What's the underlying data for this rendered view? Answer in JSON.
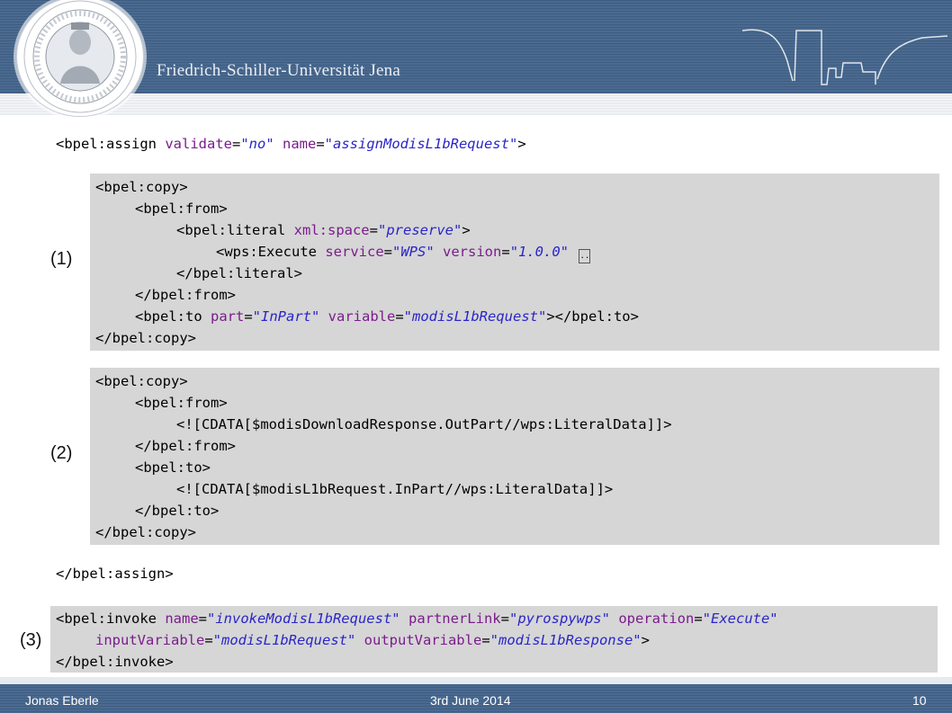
{
  "header": {
    "university_name": "Friedrich-Schiller-Universität Jena"
  },
  "code": {
    "assign_open": {
      "tag": "<bpel:assign ",
      "attr1": "validate",
      "val1": "\"no\"",
      "attr2": "name",
      "val2": "\"assignModisL1bRequest\"",
      "close": ">"
    },
    "block1": {
      "label": "(1)",
      "l1": "<bpel:copy>",
      "l2": "<bpel:from>",
      "l3_tag": "<bpel:literal ",
      "l3_attr": "xml:space",
      "l3_val": "\"preserve\"",
      "l3_close": ">",
      "l4_tag": "<wps:Execute ",
      "l4_attr1": "service",
      "l4_val1": "\"WPS\"",
      "l4_attr2": "version",
      "l4_val2": "\"1.0.0\"",
      "l4_ellipsis": "..",
      "l5": "</bpel:literal>",
      "l6": "</bpel:from>",
      "l7_tag": "<bpel:to ",
      "l7_attr1": "part",
      "l7_val1": "\"InPart\"",
      "l7_attr2": "variable",
      "l7_val2": "\"modisL1bRequest\"",
      "l7_close": "></bpel:to>",
      "l8": "</bpel:copy>"
    },
    "block2": {
      "label": "(2)",
      "l1": "<bpel:copy>",
      "l2": "<bpel:from>",
      "l3": "<![CDATA[$modisDownloadResponse.OutPart//wps:LiteralData]]>",
      "l4": "</bpel:from>",
      "l5": "<bpel:to>",
      "l6": "<![CDATA[$modisL1bRequest.InPart//wps:LiteralData]]>",
      "l7": "</bpel:to>",
      "l8": "</bpel:copy>"
    },
    "assign_close": "</bpel:assign>",
    "block3": {
      "label": "(3)",
      "l1_tag": "<bpel:invoke ",
      "l1_attr1": "name",
      "l1_val1": "\"invokeModisL1bRequest\"",
      "l1_attr2": "partnerLink",
      "l1_val2": "\"pyrospywps\"",
      "l1_attr3": "operation",
      "l1_val3": "\"Execute\"",
      "l2_attr1": "inputVariable",
      "l2_val1": "\"modisL1bRequest\"",
      "l2_attr2": "outputVariable",
      "l2_val2": "\"modisL1bResponse\"",
      "l2_close": ">",
      "l3": "</bpel:invoke>"
    }
  },
  "footer": {
    "author": "Jonas Eberle",
    "date": "3rd June 2014",
    "page": "10"
  },
  "colors": {
    "header_blue": "#4a6a90",
    "attr_purple": "#7b1c8c",
    "value_blue": "#2a25c9",
    "code_box_gray": "#d6d6d6"
  }
}
